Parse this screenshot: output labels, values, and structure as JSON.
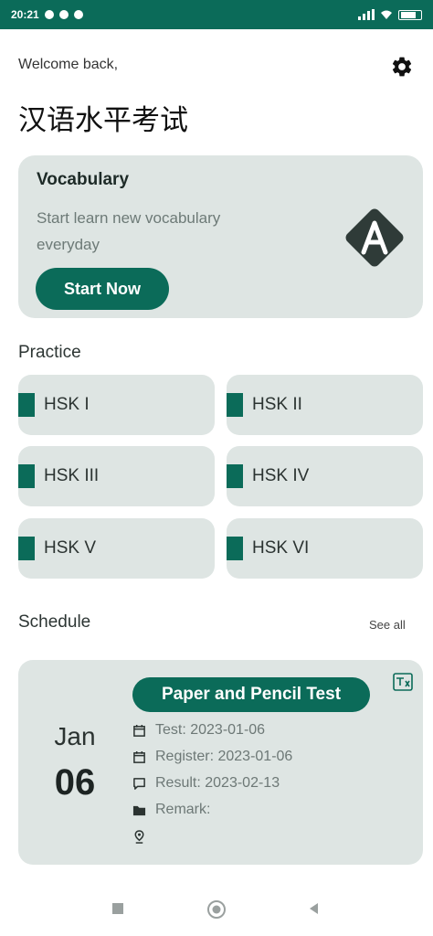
{
  "status_bar": {
    "time": "20:21"
  },
  "header": {
    "welcome": "Welcome back,",
    "title": "汉语水平考试",
    "settings_icon": "gear-icon"
  },
  "vocabulary_card": {
    "title": "Vocabulary",
    "description": "Start learn new vocabulary everyday",
    "button_label": "Start Now",
    "icon": "letter-a-icon"
  },
  "practice": {
    "label": "Practice",
    "levels": [
      {
        "label": "HSK I"
      },
      {
        "label": "HSK II"
      },
      {
        "label": "HSK III"
      },
      {
        "label": "HSK IV"
      },
      {
        "label": "HSK V"
      },
      {
        "label": "HSK VI"
      }
    ]
  },
  "schedule": {
    "label": "Schedule",
    "see_all": "See all",
    "item": {
      "month": "Jan",
      "day": "06",
      "type": "Paper and Pencil Test",
      "test": "Test: 2023-01-06",
      "register": "Register: 2023-01-06",
      "result": "Result: 2023-02-13",
      "remark": "Remark:",
      "location": ""
    }
  },
  "colors": {
    "accent": "#0b6b59",
    "card": "#dee5e3",
    "muted_text": "#6d7a77"
  }
}
